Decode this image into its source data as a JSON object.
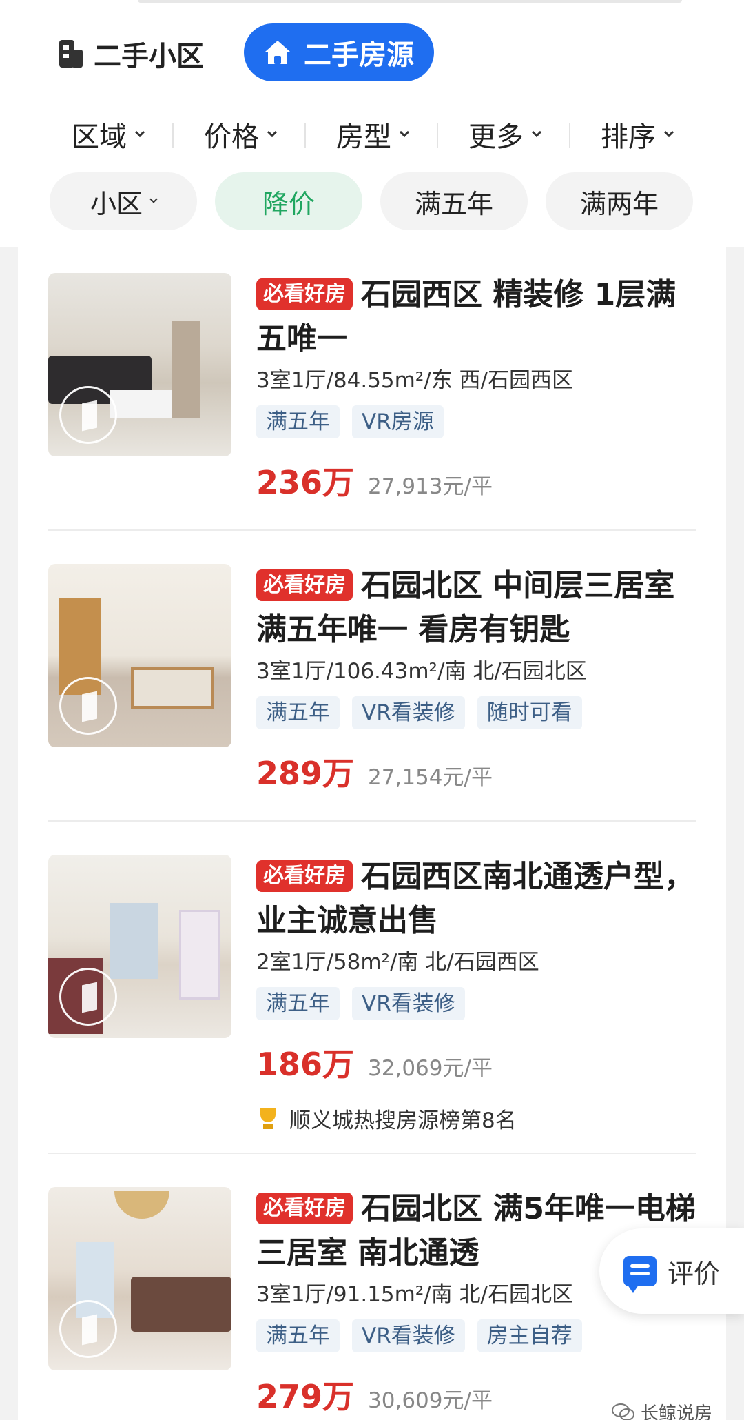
{
  "header": {
    "tabs": [
      {
        "label": "二手小区",
        "icon": "building-icon",
        "active": false
      },
      {
        "label": "二手房源",
        "icon": "house-icon",
        "active": true
      }
    ],
    "filters": [
      {
        "label": "区域"
      },
      {
        "label": "价格"
      },
      {
        "label": "房型"
      },
      {
        "label": "更多"
      },
      {
        "label": "排序"
      }
    ],
    "chips": [
      {
        "label": "小区",
        "has_dropdown": true
      },
      {
        "label": "降价",
        "active": true
      },
      {
        "label": "满五年"
      },
      {
        "label": "满两年"
      }
    ]
  },
  "listings": [
    {
      "badge": "必看好房",
      "title": "石园西区  精装修  1层满五唯一",
      "meta": "3室1厅/84.55m²/东 西/石园西区",
      "tags": [
        "满五年",
        "VR房源"
      ],
      "price": "236万",
      "unit_price": "27,913元/平"
    },
    {
      "badge": "必看好房",
      "title": "石园北区 中间层三居室 满五年唯一 看房有钥匙",
      "meta": "3室1厅/106.43m²/南 北/石园北区",
      "tags": [
        "满五年",
        "VR看装修",
        "随时可看"
      ],
      "price": "289万",
      "unit_price": "27,154元/平"
    },
    {
      "badge": "必看好房",
      "title": "石园西区南北通透户型，业主诚意出售",
      "meta": "2室1厅/58m²/南 北/石园西区",
      "tags": [
        "满五年",
        "VR看装修"
      ],
      "price": "186万",
      "unit_price": "32,069元/平",
      "rank": "顺义城热搜房源榜第8名"
    },
    {
      "badge": "必看好房",
      "title": "石园北区  满5年唯一电梯三居室  南北通透",
      "meta": "3室1厅/91.15m²/南 北/石园北区",
      "tags": [
        "满五年",
        "VR看装修",
        "房主自荐"
      ],
      "price": "279万",
      "unit_price": "30,609元/平"
    }
  ],
  "floating": {
    "evaluate_label": "评价"
  },
  "watermark": "长鲸说房",
  "colors": {
    "accent": "#1f6ef0",
    "price": "#d9302a",
    "badge": "#e0312c",
    "active_chip_text": "#20a660"
  }
}
